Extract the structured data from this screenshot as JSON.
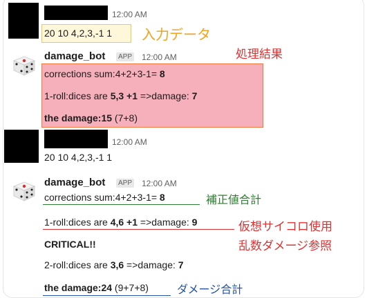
{
  "colors": {
    "input_box_border": "#f2c94c",
    "input_box_fill": "#fff7da",
    "result_box_border": "#f07b3f",
    "result_box_fill": "#f6b0bb",
    "annot_orange": "#f2a31b",
    "annot_red": "#e03131",
    "annot_green": "#2f7d32",
    "annot_blue": "#2452a8"
  },
  "messages": [
    {
      "time": "12:00 AM",
      "text": "20 10 4,2,3,-1 1",
      "annotation": "入力データ"
    },
    {
      "bot_name": "damage_bot",
      "badge": "APP",
      "time": "12:00 AM",
      "annotation": "処理結果",
      "lines": {
        "l1_pre": "corrections sum:4+2+3-1=",
        "l1_val": " 8",
        "l2_pre": "1-roll:dices are ",
        "l2_bold": "5,3 +1",
        "l2_post": " =>damage: ",
        "l2_val": "7",
        "l3_bold": "the damage:15",
        "l3_post": " (7+8)"
      }
    },
    {
      "time": "12:00 AM",
      "text": "20 10 4,2,3,-1 1"
    },
    {
      "bot_name": "damage_bot",
      "badge": "APP",
      "time": "12:00 AM",
      "lines": {
        "l1_pre": "corrections sum:4+2+3-1=",
        "l1_val": " 8",
        "l2_pre": "1-roll:dices are ",
        "l2_bold": "4,6 +1",
        "l2_post": " =>damage: ",
        "l2_val": "9",
        "l3": "CRITICAL!!",
        "l4_pre": "2-roll:dices are ",
        "l4_bold": "3,6",
        "l4_post": " =>damage: ",
        "l4_val": "7",
        "l5_bold": "the damage:24",
        "l5_post": " (9+7+8)"
      },
      "annotations": {
        "corrections": "補正値合計",
        "roll_line1": "仮想サイコロ使用",
        "roll_line2": "乱数ダメージ参照",
        "total": "ダメージ合計"
      }
    }
  ]
}
